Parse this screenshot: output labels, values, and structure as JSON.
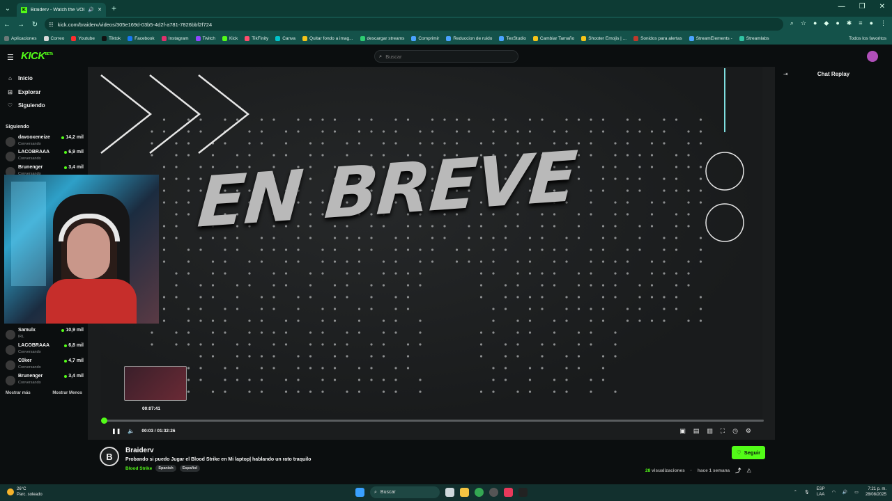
{
  "browser": {
    "tab_title": "Braiderv - Watch the VOD o",
    "url": "kick.com/braiderv/videos/305e169d-03b5-4d2f-a781-7826bbf2f724",
    "bookmarks": [
      {
        "label": "Aplicaciones",
        "color": "#6c7a78"
      },
      {
        "label": "Correo",
        "color": "#d9d9d9"
      },
      {
        "label": "Youtube",
        "color": "#ff2d2d"
      },
      {
        "label": "Tiktok",
        "color": "#111111"
      },
      {
        "label": "Facebook",
        "color": "#1877f2"
      },
      {
        "label": "Instagram",
        "color": "#e1306c"
      },
      {
        "label": "Twitch",
        "color": "#9146ff"
      },
      {
        "label": "Kick",
        "color": "#53fc18"
      },
      {
        "label": "TikFinity",
        "color": "#ff4d6d"
      },
      {
        "label": "Canva",
        "color": "#00c4cc"
      },
      {
        "label": "Quitar fondo a imag...",
        "color": "#f5c518"
      },
      {
        "label": "descargar streams",
        "color": "#2ecc71"
      },
      {
        "label": "Comprimir",
        "color": "#4aa3ff"
      },
      {
        "label": "Reduccion de ruido",
        "color": "#4aa3ff"
      },
      {
        "label": "TexStudio",
        "color": "#4aa3ff"
      },
      {
        "label": "Cambiar Tamaño",
        "color": "#f5c518"
      },
      {
        "label": "Shooter Emojis | ...",
        "color": "#f5c518"
      },
      {
        "label": "Sonidos para alertas",
        "color": "#c0392b"
      },
      {
        "label": "StreamElements -",
        "color": "#4aa3ff"
      },
      {
        "label": "Streamlabs",
        "color": "#31c3a2"
      }
    ],
    "all_bookmarks": "Todos los favoritos"
  },
  "site": {
    "logo": "KICK",
    "logo_badge": "BETA",
    "search_placeholder": "Buscar"
  },
  "sidebar": {
    "nav": [
      {
        "label": "Inicio",
        "icon": "home-icon"
      },
      {
        "label": "Explorar",
        "icon": "compass-icon"
      },
      {
        "label": "Siguiendo",
        "icon": "heart-icon"
      }
    ],
    "section_title": "Siguiendo",
    "channels_top": [
      {
        "name": "davooxeneize",
        "category": "Conversando",
        "viewers": "14,2 mil"
      },
      {
        "name": "LACOBRAAA",
        "category": "Conversando",
        "viewers": "6,9 mil"
      },
      {
        "name": "Brunenger",
        "category": "Conversando",
        "viewers": "3,4 mil"
      }
    ],
    "channels_bottom": [
      {
        "name": "Samulx",
        "category": "IRL",
        "viewers": "10,9 mil"
      },
      {
        "name": "LACOBRAAA",
        "category": "Conversando",
        "viewers": "6,8 mil"
      },
      {
        "name": "C0ker",
        "category": "Conversando",
        "viewers": "4,7 mil"
      },
      {
        "name": "Brunenger",
        "category": "Conversando",
        "viewers": "3,4 mil"
      }
    ],
    "show_more": "Mostrar más",
    "show_less": "Mostrar Menos"
  },
  "player": {
    "overlay_text": "EN BREVE",
    "hover_time": "00:07:41",
    "current_time": "00:03",
    "duration": "01:32:26",
    "progress_fraction": 0.0005
  },
  "chat": {
    "title": "Chat Replay"
  },
  "stream": {
    "channel": "Braiderv",
    "title": "Probando si puedo Jugar el Blood Strike en Mi laptop| hablando un rato traquilo",
    "category": "Blood Strike",
    "tags": [
      "Spanish",
      "Español"
    ],
    "follow_label": "Seguir",
    "views_count": "28",
    "views_label": "visualizaciones",
    "posted": "hace 1 semana"
  },
  "taskbar": {
    "temp": "26°C",
    "weather": "Parc. soleado",
    "search": "Buscar",
    "lang1": "ESP",
    "lang2": "LAA",
    "time": "7:21 p. m.",
    "date": "28/08/2025"
  }
}
